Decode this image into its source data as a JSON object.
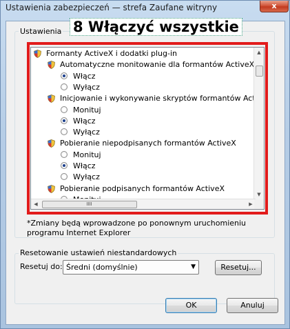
{
  "window": {
    "title": "Ustawienia zabezpieczeń — strefa Zaufane witryny",
    "close_glyph": "x"
  },
  "annotation": "8 Włączyć wszystkie",
  "settings_group": {
    "label": "Ustawienia"
  },
  "tree": {
    "category": "Formanty ActiveX i dodatki plug-in",
    "settings": [
      {
        "label": "Automatyczne monitowanie dla formantów ActiveX",
        "options": [
          {
            "label": "Włącz",
            "checked": true
          },
          {
            "label": "Wyłącz",
            "checked": false
          }
        ]
      },
      {
        "label": "Inicjowanie i wykonywanie skryptów formantów ActiveX niez",
        "options": [
          {
            "label": "Monituj",
            "checked": false
          },
          {
            "label": "Włącz",
            "checked": true
          },
          {
            "label": "Wyłącz",
            "checked": false
          }
        ]
      },
      {
        "label": "Pobieranie niepodpisanych formantów ActiveX",
        "options": [
          {
            "label": "Monituj",
            "checked": false
          },
          {
            "label": "Włącz",
            "checked": true
          },
          {
            "label": "Wyłącz",
            "checked": false
          }
        ]
      },
      {
        "label": "Pobieranie podpisanych formantów ActiveX",
        "options": [
          {
            "label": "Monituj",
            "checked": false
          }
        ]
      }
    ]
  },
  "note": "*Zmiany będą wprowadzone po ponownym uruchomieniu programu Internet Explorer",
  "reset_group": {
    "label": "Resetowanie ustawień niestandardowych",
    "reset_to_label": "Resetuj do:",
    "selected_level": "Średni (domyślnie)",
    "reset_button": "Resetuj..."
  },
  "buttons": {
    "ok": "OK",
    "cancel": "Anuluj"
  },
  "colors": {
    "highlight_frame": "#e21b1b",
    "radio_dot": "#1b3f8c"
  }
}
